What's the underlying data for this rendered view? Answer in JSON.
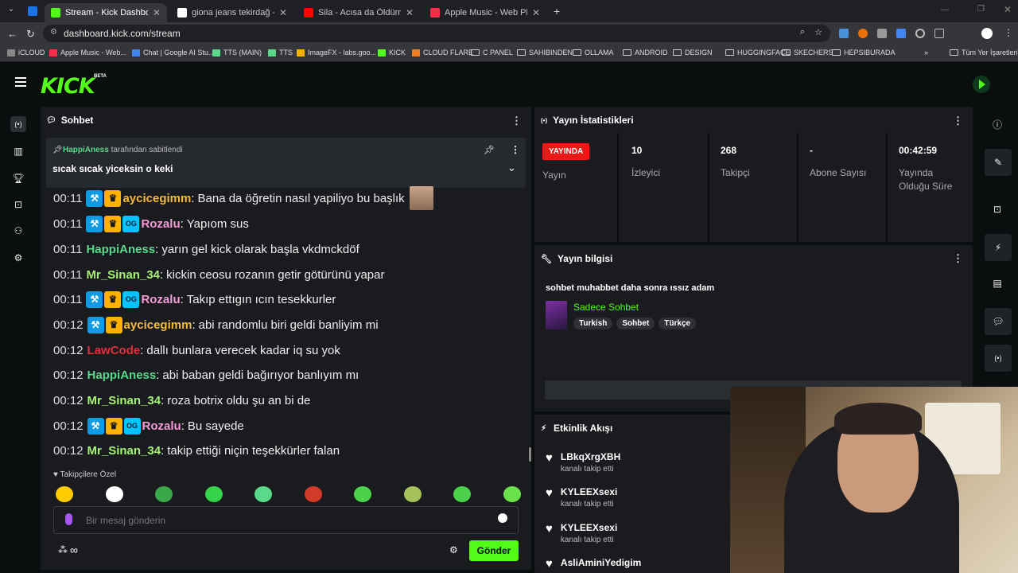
{
  "browser": {
    "tabs": [
      {
        "title": "Stream - Kick Dashboard",
        "color": "#53fc18"
      },
      {
        "title": "giona jeans tekirdağ - Google",
        "color": "#ffffff"
      },
      {
        "title": "Sila - Acısa da Öldürmez - YouT",
        "color": "#ff0000"
      },
      {
        "title": "Apple Music - Web Player",
        "color": "#fa2d48"
      }
    ],
    "url": "dashboard.kick.com/stream",
    "bookmarks": [
      "iCLOUD",
      "Apple Music - Web...",
      "Chat | Google AI Stu...",
      "TTS (MAIN)",
      "TTS",
      "ImageFX - labs.goo...",
      "KICK",
      "CLOUD FLARE",
      "C PANEL",
      "SAHIBINDEN",
      "OLLAMA",
      "ANDROID",
      "DESIGN",
      "HUGGINGFACE",
      "SKECHERS",
      "HEPSIBURADA"
    ],
    "all_bookmarks": "Tüm Yer İşaretleri"
  },
  "kick": {
    "logo": "KICK",
    "beta": "BETA",
    "accent": "#53fc18"
  },
  "chat": {
    "title": "Sohbet",
    "pinned": {
      "author": "HappiAness",
      "suffix": "tarafından sabitlendi",
      "text": "sıcak sıcak yiceksin o keki"
    },
    "messages": [
      {
        "time": "00:11",
        "badges": [
          "mod",
          "vip"
        ],
        "user": "aycicegimm",
        "color": "#f5b93c",
        "text": "Bana da öğretin nasıl yapiliyo bu başlık"
      },
      {
        "time": "00:11",
        "badges": [
          "mod",
          "vip",
          "og"
        ],
        "user": "Rozalu",
        "color": "#f59bd7",
        "text": "Yapıom sus"
      },
      {
        "time": "00:11",
        "badges": [],
        "user": "HappiAness",
        "color": "#5ad98a",
        "text": "yarın gel kick olarak başla vkdmckdöf"
      },
      {
        "time": "00:11",
        "badges": [],
        "user": "Mr_Sinan_34",
        "color": "#a6f275",
        "text": "kickin ceosu rozanın getir götürünü yapar"
      },
      {
        "time": "00:11",
        "badges": [
          "mod",
          "vip",
          "og"
        ],
        "user": "Rozalu",
        "color": "#f59bd7",
        "text": "Takıp ettıgın ıcın tesekkurler"
      },
      {
        "time": "00:12",
        "badges": [
          "mod",
          "vip"
        ],
        "user": "aycicegimm",
        "color": "#f5b93c",
        "text": "abi randomlu biri geldi banliyim mi"
      },
      {
        "time": "00:12",
        "badges": [],
        "user": "LawCode",
        "color": "#e1303c",
        "text": "dallı bunlara verecek kadar iq su yok"
      },
      {
        "time": "00:12",
        "badges": [],
        "user": "HappiAness",
        "color": "#5ad98a",
        "text": "abi baban geldi bağırıyor banlıyım mı"
      },
      {
        "time": "00:12",
        "badges": [],
        "user": "Mr_Sinan_34",
        "color": "#a6f275",
        "text": "roza botrix oldu şu an bi de"
      },
      {
        "time": "00:12",
        "badges": [
          "mod",
          "vip",
          "og"
        ],
        "user": "Rozalu",
        "color": "#f59bd7",
        "text": "Bu sayede"
      },
      {
        "time": "00:12",
        "badges": [],
        "user": "Mr_Sinan_34",
        "color": "#a6f275",
        "text": "takip ettiği niçin teşekkürler falan"
      }
    ],
    "followers_only": "Takipçilere Özel",
    "placeholder": "Bir mesaj gönderin",
    "send": "Gönder",
    "infinity": "∞"
  },
  "stats": {
    "title": "Yayın İstatistikleri",
    "live_badge": "YAYINDA",
    "live_label": "Yayın",
    "items": [
      {
        "value": "10",
        "label": "İzleyici"
      },
      {
        "value": "268",
        "label": "Takipçi"
      },
      {
        "value": "-",
        "label": "Abone Sayısı"
      },
      {
        "value": "00:42:59",
        "label": "Yayında Olduğu Süre"
      }
    ]
  },
  "info": {
    "title": "Yayın bilgisi",
    "stream_title": "sohbet muhabbet daha sonra ıssız adam",
    "category": "Sadece Sohbet",
    "tags": [
      "Turkish",
      "Sohbet",
      "Türkçe"
    ]
  },
  "activity": {
    "title": "Etkinlik Akışı",
    "events": [
      {
        "name": "LBkqXrgXBH",
        "action": "kanalı takip etti"
      },
      {
        "name": "KYLEEXsexi",
        "action": "kanalı takip etti"
      },
      {
        "name": "KYLEEXsexi",
        "action": "kanalı takip etti"
      },
      {
        "name": "AsliAminiYedigim",
        "action": ""
      }
    ]
  }
}
